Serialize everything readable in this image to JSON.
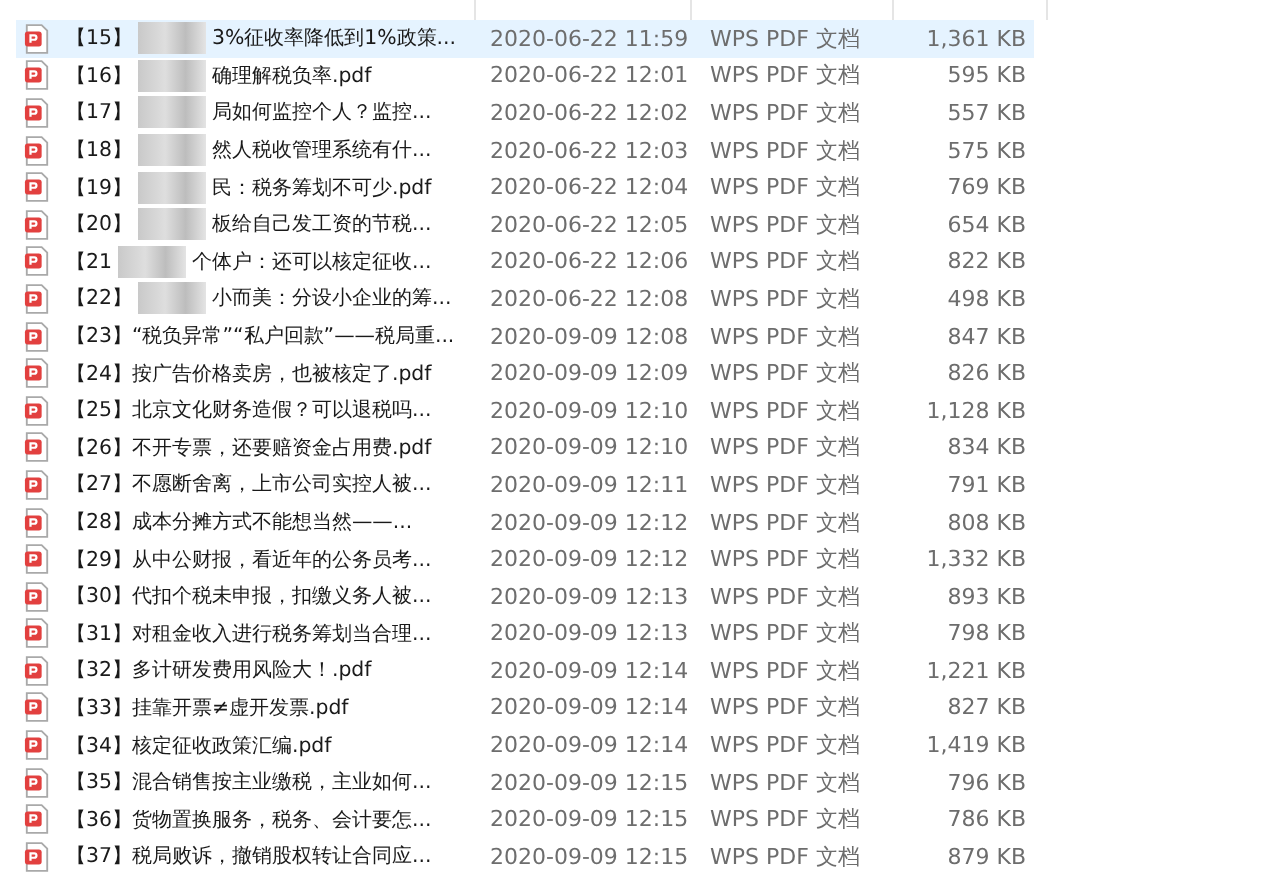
{
  "rows": [
    {
      "number": "【15】",
      "name": "3%征收率降低到1%政策...",
      "blurred": true,
      "selected": true,
      "date": "2020-06-22 11:59",
      "type": "WPS PDF 文档",
      "size": "1,361 KB"
    },
    {
      "number": "【16】",
      "name": "确理解税负率.pdf",
      "blurred": true,
      "selected": false,
      "date": "2020-06-22 12:01",
      "type": "WPS PDF 文档",
      "size": "595 KB"
    },
    {
      "number": "【17】",
      "name": "局如何监控个人？监控...",
      "blurred": true,
      "selected": false,
      "date": "2020-06-22 12:02",
      "type": "WPS PDF 文档",
      "size": "557 KB"
    },
    {
      "number": "【18】",
      "name": "然人税收管理系统有什...",
      "blurred": true,
      "selected": false,
      "date": "2020-06-22 12:03",
      "type": "WPS PDF 文档",
      "size": "575 KB"
    },
    {
      "number": "【19】",
      "name": "民：税务筹划不可少.pdf",
      "blurred": true,
      "selected": false,
      "date": "2020-06-22 12:04",
      "type": "WPS PDF 文档",
      "size": "769 KB"
    },
    {
      "number": "【20】",
      "name": "板给自己发工资的节税...",
      "blurred": true,
      "selected": false,
      "date": "2020-06-22 12:05",
      "type": "WPS PDF 文档",
      "size": "654 KB"
    },
    {
      "number": "【21",
      "name": "个体户：还可以核定征收...",
      "blurred": true,
      "selected": false,
      "date": "2020-06-22 12:06",
      "type": "WPS PDF 文档",
      "size": "822 KB"
    },
    {
      "number": "【22】",
      "name": "小而美：分设小企业的筹...",
      "blurred": true,
      "selected": false,
      "date": "2020-06-22 12:08",
      "type": "WPS PDF 文档",
      "size": "498 KB"
    },
    {
      "number": "【23】",
      "name": "“税负异常”“私户回款”——税局重...",
      "blurred": false,
      "selected": false,
      "date": "2020-09-09 12:08",
      "type": "WPS PDF 文档",
      "size": "847 KB"
    },
    {
      "number": "【24】",
      "name": "按广告价格卖房，也被核定了.pdf",
      "blurred": false,
      "selected": false,
      "date": "2020-09-09 12:09",
      "type": "WPS PDF 文档",
      "size": "826 KB"
    },
    {
      "number": "【25】",
      "name": "北京文化财务造假？可以退税吗...",
      "blurred": false,
      "selected": false,
      "date": "2020-09-09 12:10",
      "type": "WPS PDF 文档",
      "size": "1,128 KB"
    },
    {
      "number": "【26】",
      "name": "不开专票，还要赔资金占用费.pdf",
      "blurred": false,
      "selected": false,
      "date": "2020-09-09 12:10",
      "type": "WPS PDF 文档",
      "size": "834 KB"
    },
    {
      "number": "【27】",
      "name": "不愿断舍离，上市公司实控人被...",
      "blurred": false,
      "selected": false,
      "date": "2020-09-09 12:11",
      "type": "WPS PDF 文档",
      "size": "791 KB"
    },
    {
      "number": "【28】",
      "name": "成本分摊方式不能想当然——...",
      "blurred": false,
      "selected": false,
      "date": "2020-09-09 12:12",
      "type": "WPS PDF 文档",
      "size": "808 KB"
    },
    {
      "number": "【29】",
      "name": "从中公财报，看近年的公务员考...",
      "blurred": false,
      "selected": false,
      "date": "2020-09-09 12:12",
      "type": "WPS PDF 文档",
      "size": "1,332 KB"
    },
    {
      "number": "【30】",
      "name": "代扣个税未申报，扣缴义务人被...",
      "blurred": false,
      "selected": false,
      "date": "2020-09-09 12:13",
      "type": "WPS PDF 文档",
      "size": "893 KB"
    },
    {
      "number": "【31】",
      "name": "对租金收入进行税务筹划当合理...",
      "blurred": false,
      "selected": false,
      "date": "2020-09-09 12:13",
      "type": "WPS PDF 文档",
      "size": "798 KB"
    },
    {
      "number": "【32】",
      "name": "多计研发费用风险大！.pdf",
      "blurred": false,
      "selected": false,
      "date": "2020-09-09 12:14",
      "type": "WPS PDF 文档",
      "size": "1,221 KB"
    },
    {
      "number": "【33】",
      "name": "挂靠开票≠虚开发票.pdf",
      "blurred": false,
      "selected": false,
      "date": "2020-09-09 12:14",
      "type": "WPS PDF 文档",
      "size": "827 KB"
    },
    {
      "number": "【34】",
      "name": "核定征收政策汇编.pdf",
      "blurred": false,
      "selected": false,
      "date": "2020-09-09 12:14",
      "type": "WPS PDF 文档",
      "size": "1,419 KB"
    },
    {
      "number": "【35】",
      "name": "混合销售按主业缴税，主业如何...",
      "blurred": false,
      "selected": false,
      "date": "2020-09-09 12:15",
      "type": "WPS PDF 文档",
      "size": "796 KB"
    },
    {
      "number": "【36】",
      "name": "货物置换服务，税务、会计要怎...",
      "blurred": false,
      "selected": false,
      "date": "2020-09-09 12:15",
      "type": "WPS PDF 文档",
      "size": "786 KB"
    },
    {
      "number": "【37】",
      "name": "税局败诉，撤销股权转让合同应...",
      "blurred": false,
      "selected": false,
      "date": "2020-09-09 12:15",
      "type": "WPS PDF 文档",
      "size": "879 KB"
    }
  ]
}
